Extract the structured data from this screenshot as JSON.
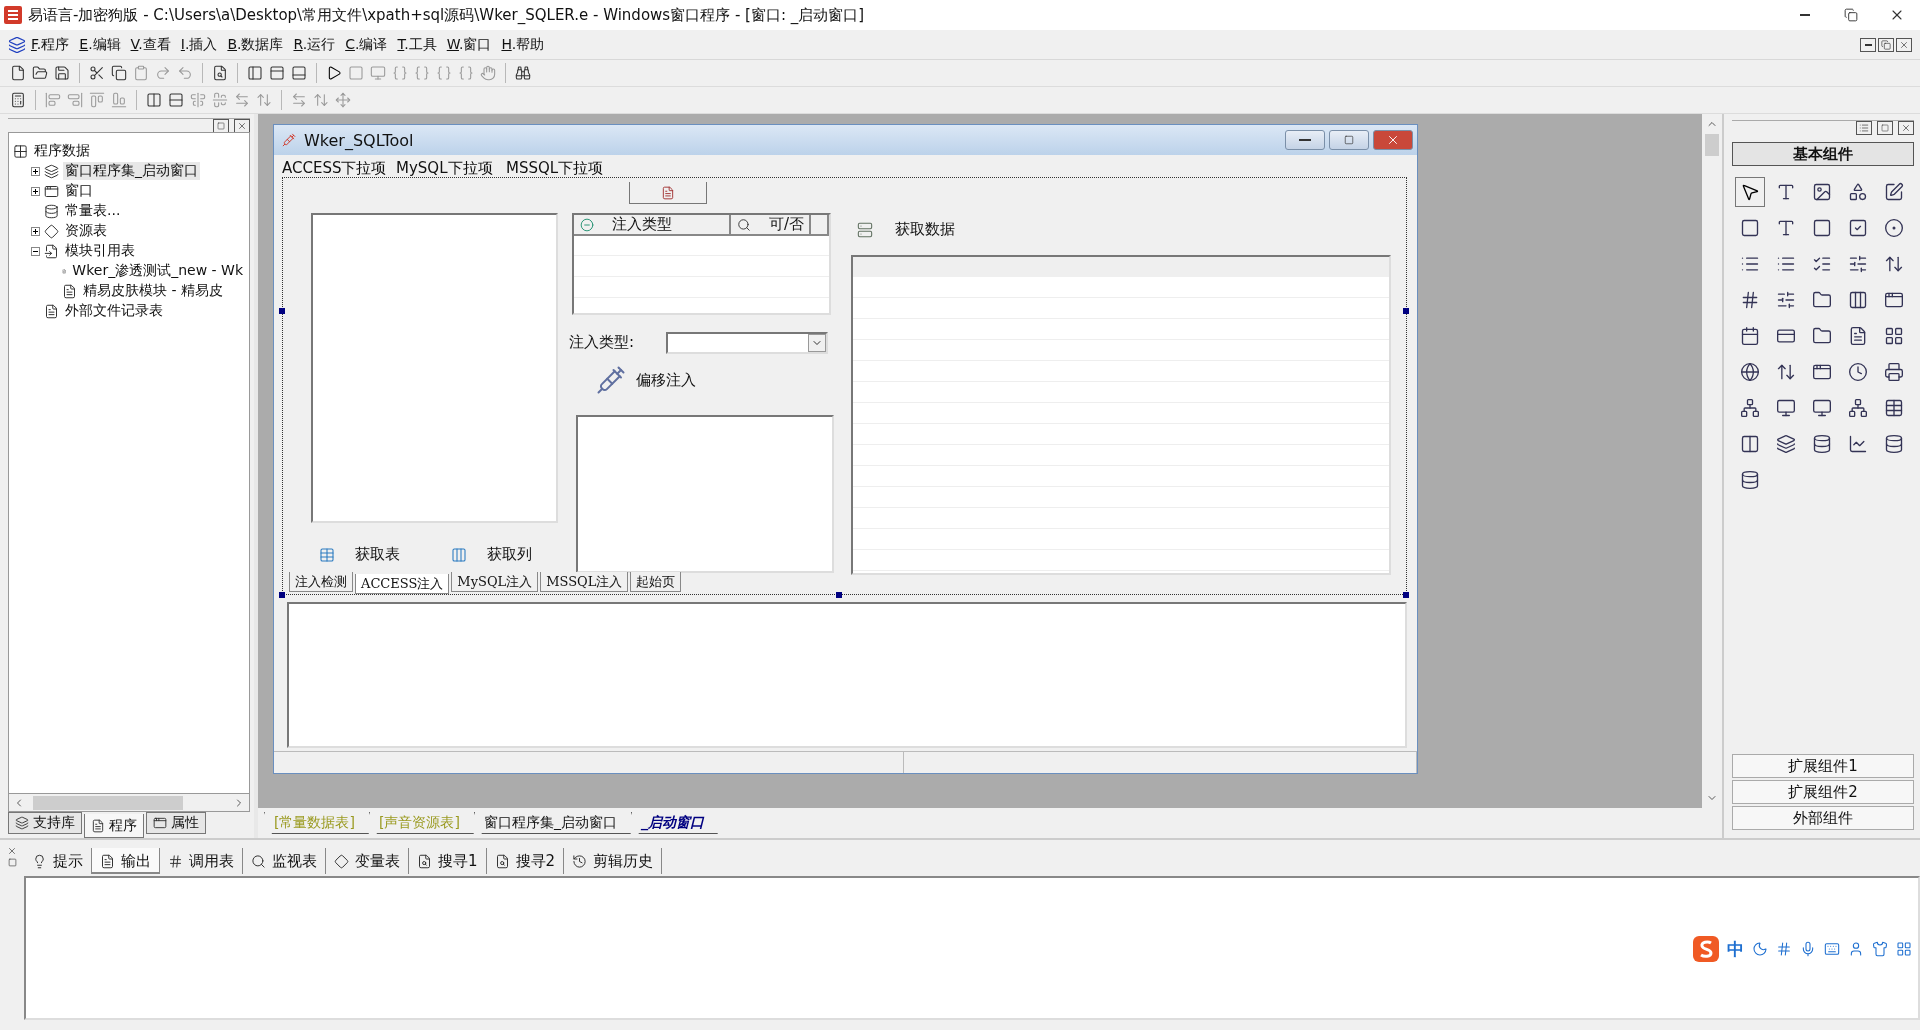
{
  "window": {
    "title": "易语言-加密狗版 - C:\\Users\\a\\Desktop\\常用文件\\xpath+sql源码\\Wker_SQLER.e - Windows窗口程序 - [窗口: _启动窗口]"
  },
  "menu": [
    {
      "label": "F.程序"
    },
    {
      "label": "E.编辑"
    },
    {
      "label": "V.查看"
    },
    {
      "label": "I.插入"
    },
    {
      "label": "B.数据库"
    },
    {
      "label": "R.运行"
    },
    {
      "label": "C.编译"
    },
    {
      "label": "T.工具"
    },
    {
      "label": "W.窗口"
    },
    {
      "label": "H.帮助"
    }
  ],
  "project_tree": {
    "label": "程序数据",
    "kind": "program",
    "selected": false,
    "children": [
      {
        "label": "窗口程序集_启动窗口",
        "kind": "assembly",
        "selected": true,
        "expanded": false
      },
      {
        "label": "窗口",
        "kind": "window",
        "selected": false,
        "expanded": false
      },
      {
        "label": "常量表...",
        "kind": "constants",
        "selected": false
      },
      {
        "label": "资源表",
        "kind": "resources",
        "selected": false,
        "expanded": false
      },
      {
        "label": "模块引用表",
        "kind": "modules",
        "selected": false,
        "expanded": true,
        "children": [
          {
            "label": "Wker_渗透测试_new - Wk",
            "kind": "file",
            "selected": false
          },
          {
            "label": "精易皮肤模块 - 精易皮",
            "kind": "file",
            "selected": false
          }
        ]
      },
      {
        "label": "外部文件记录表",
        "kind": "file",
        "selected": false
      }
    ]
  },
  "left_tabs": [
    {
      "label": "支持库",
      "selected": false
    },
    {
      "label": "程序",
      "selected": true
    },
    {
      "label": "属性",
      "selected": false
    }
  ],
  "form": {
    "title": "Wker_SQLTool",
    "menu": [
      {
        "label": "ACCESS下拉项"
      },
      {
        "label": "MySQL下拉项"
      },
      {
        "label": "MSSQL下拉项"
      }
    ],
    "get_table": "获取表",
    "get_column": "获取列",
    "listview_columns": [
      {
        "label": "注入类型",
        "kind": "type"
      },
      {
        "label": "可/否",
        "kind": "search"
      }
    ],
    "combo_label": "注入类型:",
    "offset_button": "偏移注入",
    "get_data": "获取数据",
    "tabs": [
      {
        "label": "注入检测",
        "selected": false
      },
      {
        "label": "ACCESS注入",
        "selected": true
      },
      {
        "label": "MySQL注入",
        "selected": false
      },
      {
        "label": "MSSQL注入",
        "selected": false
      },
      {
        "label": "起始页",
        "selected": false
      }
    ]
  },
  "doc_tabs": [
    {
      "label": "[常量数据表]",
      "kind": "resource",
      "selected": false
    },
    {
      "label": "[声音资源表]",
      "kind": "resource",
      "selected": false
    },
    {
      "label": "窗口程序集_启动窗口",
      "kind": "module",
      "selected": false
    },
    {
      "label": "_启动窗口",
      "kind": "module",
      "selected": true
    }
  ],
  "palette": [
    {
      "label": "基本组件",
      "selected": true
    },
    {
      "label": "扩展组件1",
      "selected": false
    },
    {
      "label": "扩展组件2",
      "selected": false
    },
    {
      "label": "外部组件",
      "selected": false
    }
  ],
  "output_tabs": [
    {
      "label": "提示",
      "kind": "hint",
      "selected": false
    },
    {
      "label": "输出",
      "kind": "output",
      "selected": true
    },
    {
      "label": "调用表",
      "kind": "calls",
      "selected": false
    },
    {
      "label": "监视表",
      "kind": "watch",
      "selected": false
    },
    {
      "label": "变量表",
      "kind": "vars",
      "selected": false
    },
    {
      "label": "搜寻1",
      "kind": "find",
      "selected": false
    },
    {
      "label": "搜寻2",
      "kind": "find",
      "selected": false
    },
    {
      "label": "剪辑历史",
      "kind": "clip",
      "selected": false
    }
  ],
  "ime": {
    "mode": "中"
  }
}
